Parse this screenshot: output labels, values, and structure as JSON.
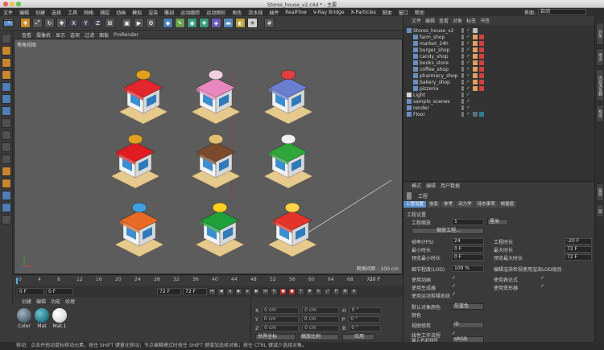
{
  "window": {
    "title": "Stores_house_v2.c4d * - 主要"
  },
  "menu": [
    "文件",
    "编辑",
    "创建",
    "选择",
    "工具",
    "网格",
    "捕捉",
    "动画",
    "模拟",
    "渲染",
    "雕刻",
    "运动跟踪",
    "运动图形",
    "角色",
    "流水线",
    "插件",
    "RealFlow",
    "V-Ray Bridge",
    "X-Particles",
    "脚本",
    "窗口",
    "帮助"
  ],
  "layout": {
    "label": "界面:",
    "value": "启动"
  },
  "toolbar": {
    "axis_labels": [
      "X",
      "Y",
      "Z"
    ]
  },
  "viewport": {
    "menu": [
      "查看",
      "摄像机",
      "显示",
      "选项",
      "过滤",
      "面板",
      "ProRender"
    ],
    "label": "等角视图",
    "grid_info": "网格间距 : 100 cm",
    "buildings": [
      {
        "roof": "#e5252c",
        "sign": "#e0a020"
      },
      {
        "roof": "#e888c0",
        "sign": "#f0d0e0"
      },
      {
        "roof": "#6a7fd0",
        "sign": "#e04040"
      },
      {
        "roof": "#e01c22",
        "sign": "#e0a020"
      },
      {
        "roof": "#7b4a2a",
        "sign": "#e0c070"
      },
      {
        "roof": "#2ea63a",
        "sign": "#f0f0f0"
      },
      {
        "roof": "#e86a26",
        "sign": "#40a0e0"
      },
      {
        "roof": "#1fa03a",
        "sign": "#ffd020"
      },
      {
        "roof": "#e4342a",
        "sign": "#ffd34a"
      }
    ]
  },
  "timeline": {
    "ticks": [
      "0",
      "4",
      "8",
      "12",
      "16",
      "20",
      "24",
      "28",
      "32",
      "36",
      "40",
      "44",
      "48",
      "52",
      "56",
      "60",
      "64",
      "68",
      "72"
    ],
    "end_label": "-20 F"
  },
  "transport": {
    "current": "0 F",
    "start": "0 F",
    "end": "72 F",
    "end2": "72 F"
  },
  "materials": {
    "menu": [
      "创建",
      "编辑",
      "功能",
      "纹理"
    ],
    "items": [
      {
        "label": "Color",
        "color": "#5b6f7d"
      },
      {
        "label": "Mat",
        "color": "#2c7f8d"
      },
      {
        "label": "Mat.1",
        "color": "#f0f0f0"
      }
    ]
  },
  "coords": {
    "rows": [
      {
        "axis": "X",
        "pos": "0 cm",
        "size": "0 cm",
        "rot_label": "H",
        "rot": "0 °"
      },
      {
        "axis": "Y",
        "pos": "0 cm",
        "size": "0 cm",
        "rot_label": "P",
        "rot": "0 °"
      },
      {
        "axis": "Z",
        "pos": "0 cm",
        "size": "0 cm",
        "rot_label": "B",
        "rot": "0 °"
      }
    ],
    "mode1": "世界坐标",
    "mode2": "缩放比例",
    "apply": "应用"
  },
  "objects": {
    "menu": [
      "文件",
      "编辑",
      "查看",
      "对象",
      "标签",
      "书签"
    ],
    "root": "Stores_house_v2",
    "children": [
      "farm_shop",
      "market_24h",
      "burger_shop",
      "candy_shop",
      "books_store",
      "coffee_shop",
      "pharmacy_shop",
      "bakery_shop",
      "pizzeria"
    ],
    "others": [
      "Light",
      "sample_scenes",
      "render",
      "Floor"
    ]
  },
  "attributes": {
    "menu": [
      "模式",
      "编辑",
      "用户数据"
    ],
    "header": "工程",
    "tabs": [
      "工程设置",
      "信息",
      "参考",
      "动力学",
      "待办事项",
      "帧插值"
    ],
    "section": "工程设置",
    "scale_label": "工程缩放",
    "scale_value": "1",
    "scale_unit": "厘米",
    "scale_button": "缩放工程...",
    "fps_label": "帧率(FPS)",
    "fps_value": "24",
    "min_time_label": "最小时长",
    "min_time_value": "0 F",
    "preview_min_label": "预览最小时长",
    "preview_min_value": "0 F",
    "lod_label": "细节程度(LOD)",
    "lod_value": "100 %",
    "project_time_label": "工程时长",
    "project_time_value": "-20 F",
    "max_time_label": "最大时长",
    "max_time_value": "72 F",
    "preview_max_label": "预览最大时长",
    "preview_max_value": "72 F",
    "render_lod_label": "编辑渲染检视使用渲染LOD级别",
    "anim_label": "使用动画",
    "expr_label": "使用表达式",
    "gen_label": "使用生成器",
    "deform_label": "使用变形器",
    "motion_label": "使用运动剪辑系统",
    "default_color_label": "默认对象颜色",
    "default_color_value": "灰蓝色",
    "color_label": "颜色",
    "view_clip_label": "视图修剪",
    "view_clip_value": "中",
    "linear_label": "线性工作流程",
    "input_color_label": "输入色彩特性",
    "input_color_value": "sRGB"
  },
  "side_tabs": [
    "对象",
    "场次",
    "内容浏览器",
    "构造",
    "属性",
    "层"
  ],
  "status": "移动：点击并拖动鼠标移动元素。按住 SHIFT 键量化移动；节点编辑模式时按住 SHIFT 键增加选择对象；按住 CTRL 键减少选择对象。"
}
